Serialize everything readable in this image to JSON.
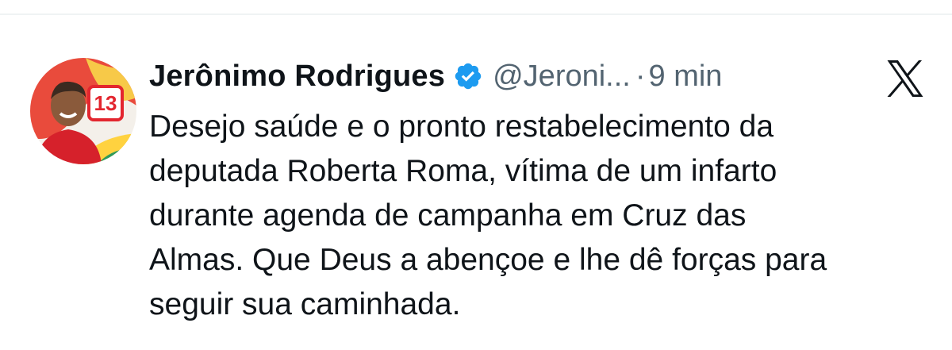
{
  "tweet": {
    "author": {
      "display_name": "Jerônimo Rodrigues",
      "handle": "@Jeroni...",
      "avatar_badge_number": "13",
      "verified": true,
      "verified_color": "#1d9bf0"
    },
    "separator": "·",
    "time": "9 min",
    "text": "Desejo saúde e o pronto restabelecimento da\ndeputada Roberta Roma, vítima de um infarto\ndurante agenda de campanha em Cruz das\nAlmas. Que Deus a abençoe e lhe dê forças para\nseguir sua caminhada.",
    "platform_icon": "x-logo-icon"
  },
  "colors": {
    "text_primary": "#0f1419",
    "text_secondary": "#536471",
    "divider": "#eff3f4",
    "avatar_red": "#e3262f"
  }
}
